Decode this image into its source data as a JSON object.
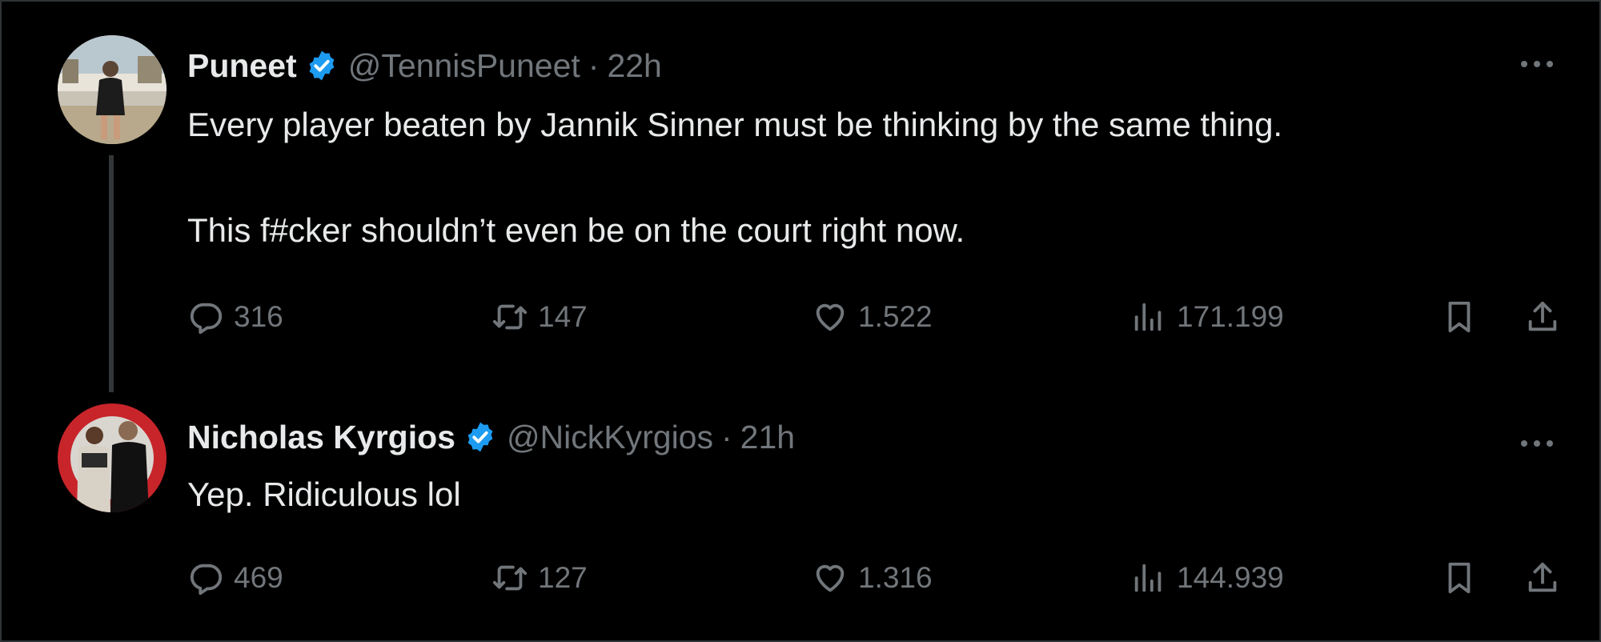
{
  "colors": {
    "background": "#000000",
    "text_primary": "#e7e9ea",
    "text_secondary": "#71767b",
    "verified_badge": "#1d9bf0",
    "border": "#2f3336"
  },
  "tweets": [
    {
      "author_name": "Puneet",
      "handle": "@TennisPuneet",
      "separator": "·",
      "time": "22h",
      "verified": true,
      "text_lines": [
        "Every player beaten by Jannik Sinner must be thinking by the same thing.",
        "This f#cker shouldn’t even be on the court right now."
      ],
      "replies": "316",
      "retweets": "147",
      "likes": "1.522",
      "views": "171.199"
    },
    {
      "author_name": "Nicholas Kyrgios",
      "handle": "@NickKyrgios",
      "separator": "·",
      "time": "21h",
      "verified": true,
      "text_lines": [
        "Yep. Ridiculous lol"
      ],
      "replies": "469",
      "retweets": "127",
      "likes": "1.316",
      "views": "144.939"
    }
  ],
  "icons": {
    "verified": "verified-badge-icon",
    "more": "more-options-icon",
    "reply": "reply-icon",
    "retweet": "retweet-icon",
    "like": "like-heart-icon",
    "views": "views-chart-icon",
    "bookmark": "bookmark-icon",
    "share": "share-icon"
  }
}
